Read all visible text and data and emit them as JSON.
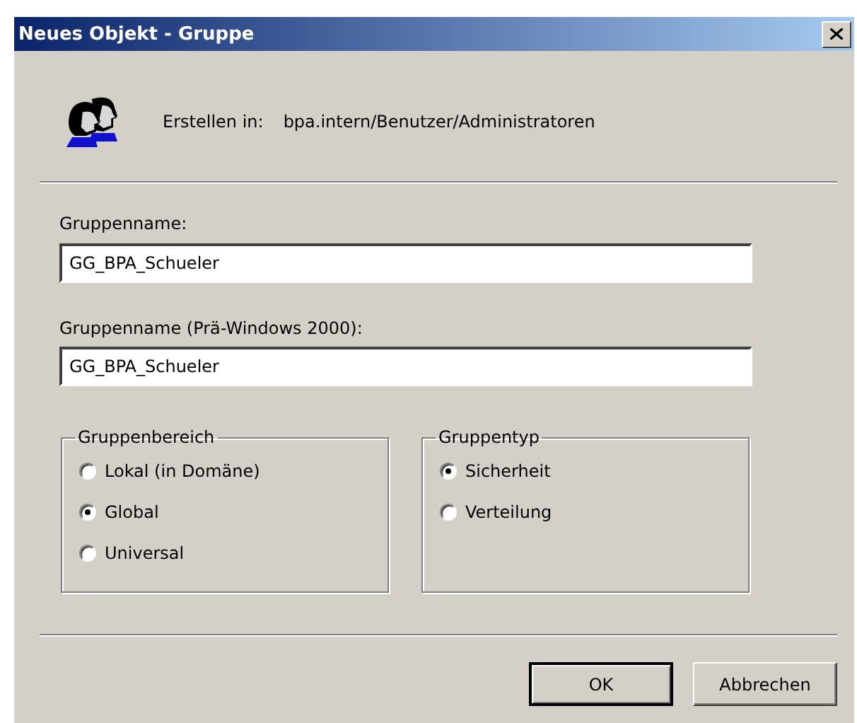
{
  "window": {
    "title": "Neues Objekt - Gruppe"
  },
  "create_in": {
    "label": "Erstellen in:",
    "path": "bpa.intern/Benutzer/Administratoren"
  },
  "fields": [
    {
      "label": "Gruppenname:",
      "value": "GG_BPA_Schueler"
    },
    {
      "label": "Gruppenname (Prä-Windows 2000):",
      "value": "GG_BPA_Schueler"
    }
  ],
  "groups": [
    {
      "title": "Gruppenbereich",
      "options": [
        {
          "label": "Lokal (in Domäne)",
          "selected": false
        },
        {
          "label": "Global",
          "selected": true
        },
        {
          "label": "Universal",
          "selected": false
        }
      ]
    },
    {
      "title": "Gruppentyp",
      "options": [
        {
          "label": "Sicherheit",
          "selected": true
        },
        {
          "label": "Verteilung",
          "selected": false
        }
      ]
    }
  ],
  "buttons": [
    {
      "label": "OK",
      "default": true
    },
    {
      "label": "Abbrechen",
      "default": false
    }
  ]
}
